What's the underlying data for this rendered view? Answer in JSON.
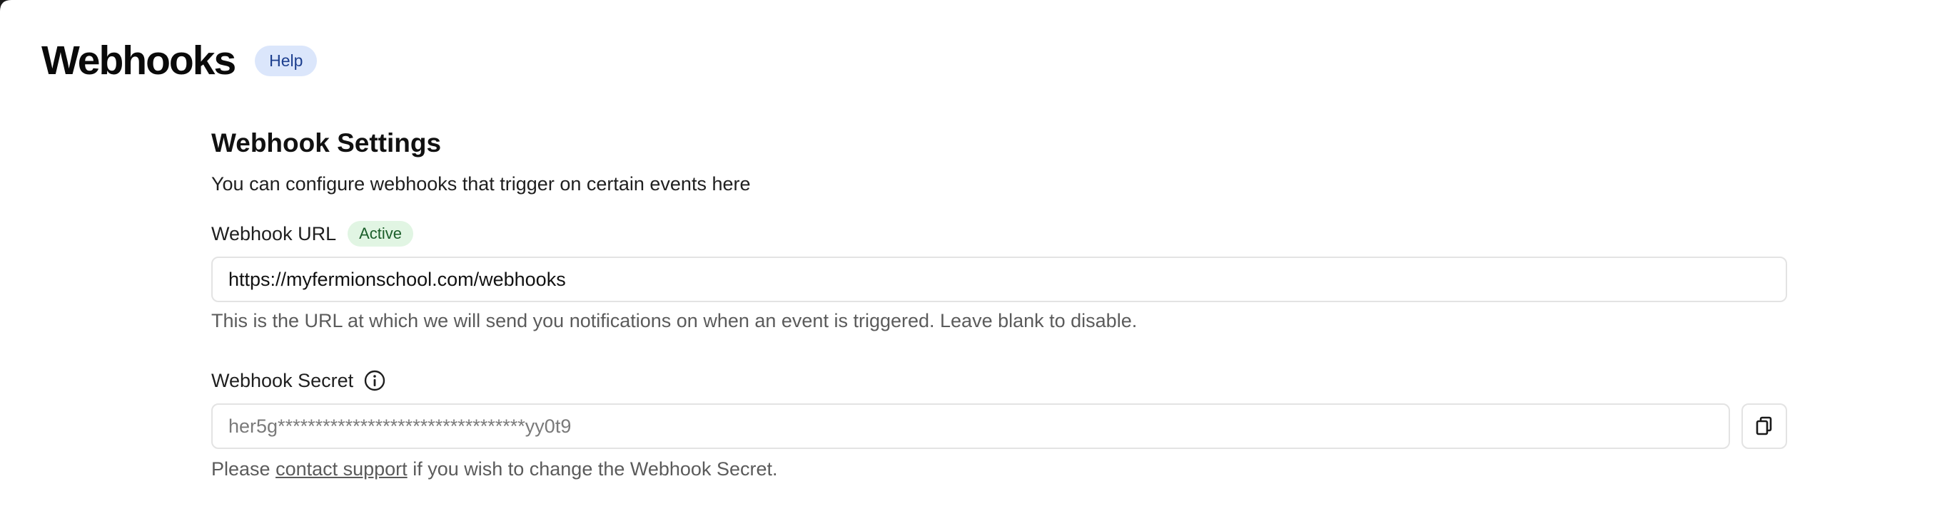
{
  "header": {
    "title": "Webhooks",
    "help_label": "Help"
  },
  "settings": {
    "title": "Webhook Settings",
    "description": "You can configure webhooks that trigger on certain events here",
    "url_field": {
      "label": "Webhook URL",
      "status": "Active",
      "value": "https://myfermionschool.com/webhooks",
      "helper": "This is the URL at which we will send you notifications on when an event is triggered. Leave blank to disable."
    },
    "secret_field": {
      "label": "Webhook Secret",
      "value": "her5g*********************************yy0t9",
      "helper_prefix": "Please ",
      "helper_link": "contact support",
      "helper_suffix": " if you wish to change the Webhook Secret."
    }
  },
  "icons": {
    "info": "info-icon",
    "copy": "copy-icon"
  },
  "colors": {
    "help_badge_bg": "#dbe6fb",
    "help_badge_text": "#1d3f8f",
    "active_badge_bg": "#e1f5e3",
    "active_badge_text": "#1b5e2a"
  }
}
